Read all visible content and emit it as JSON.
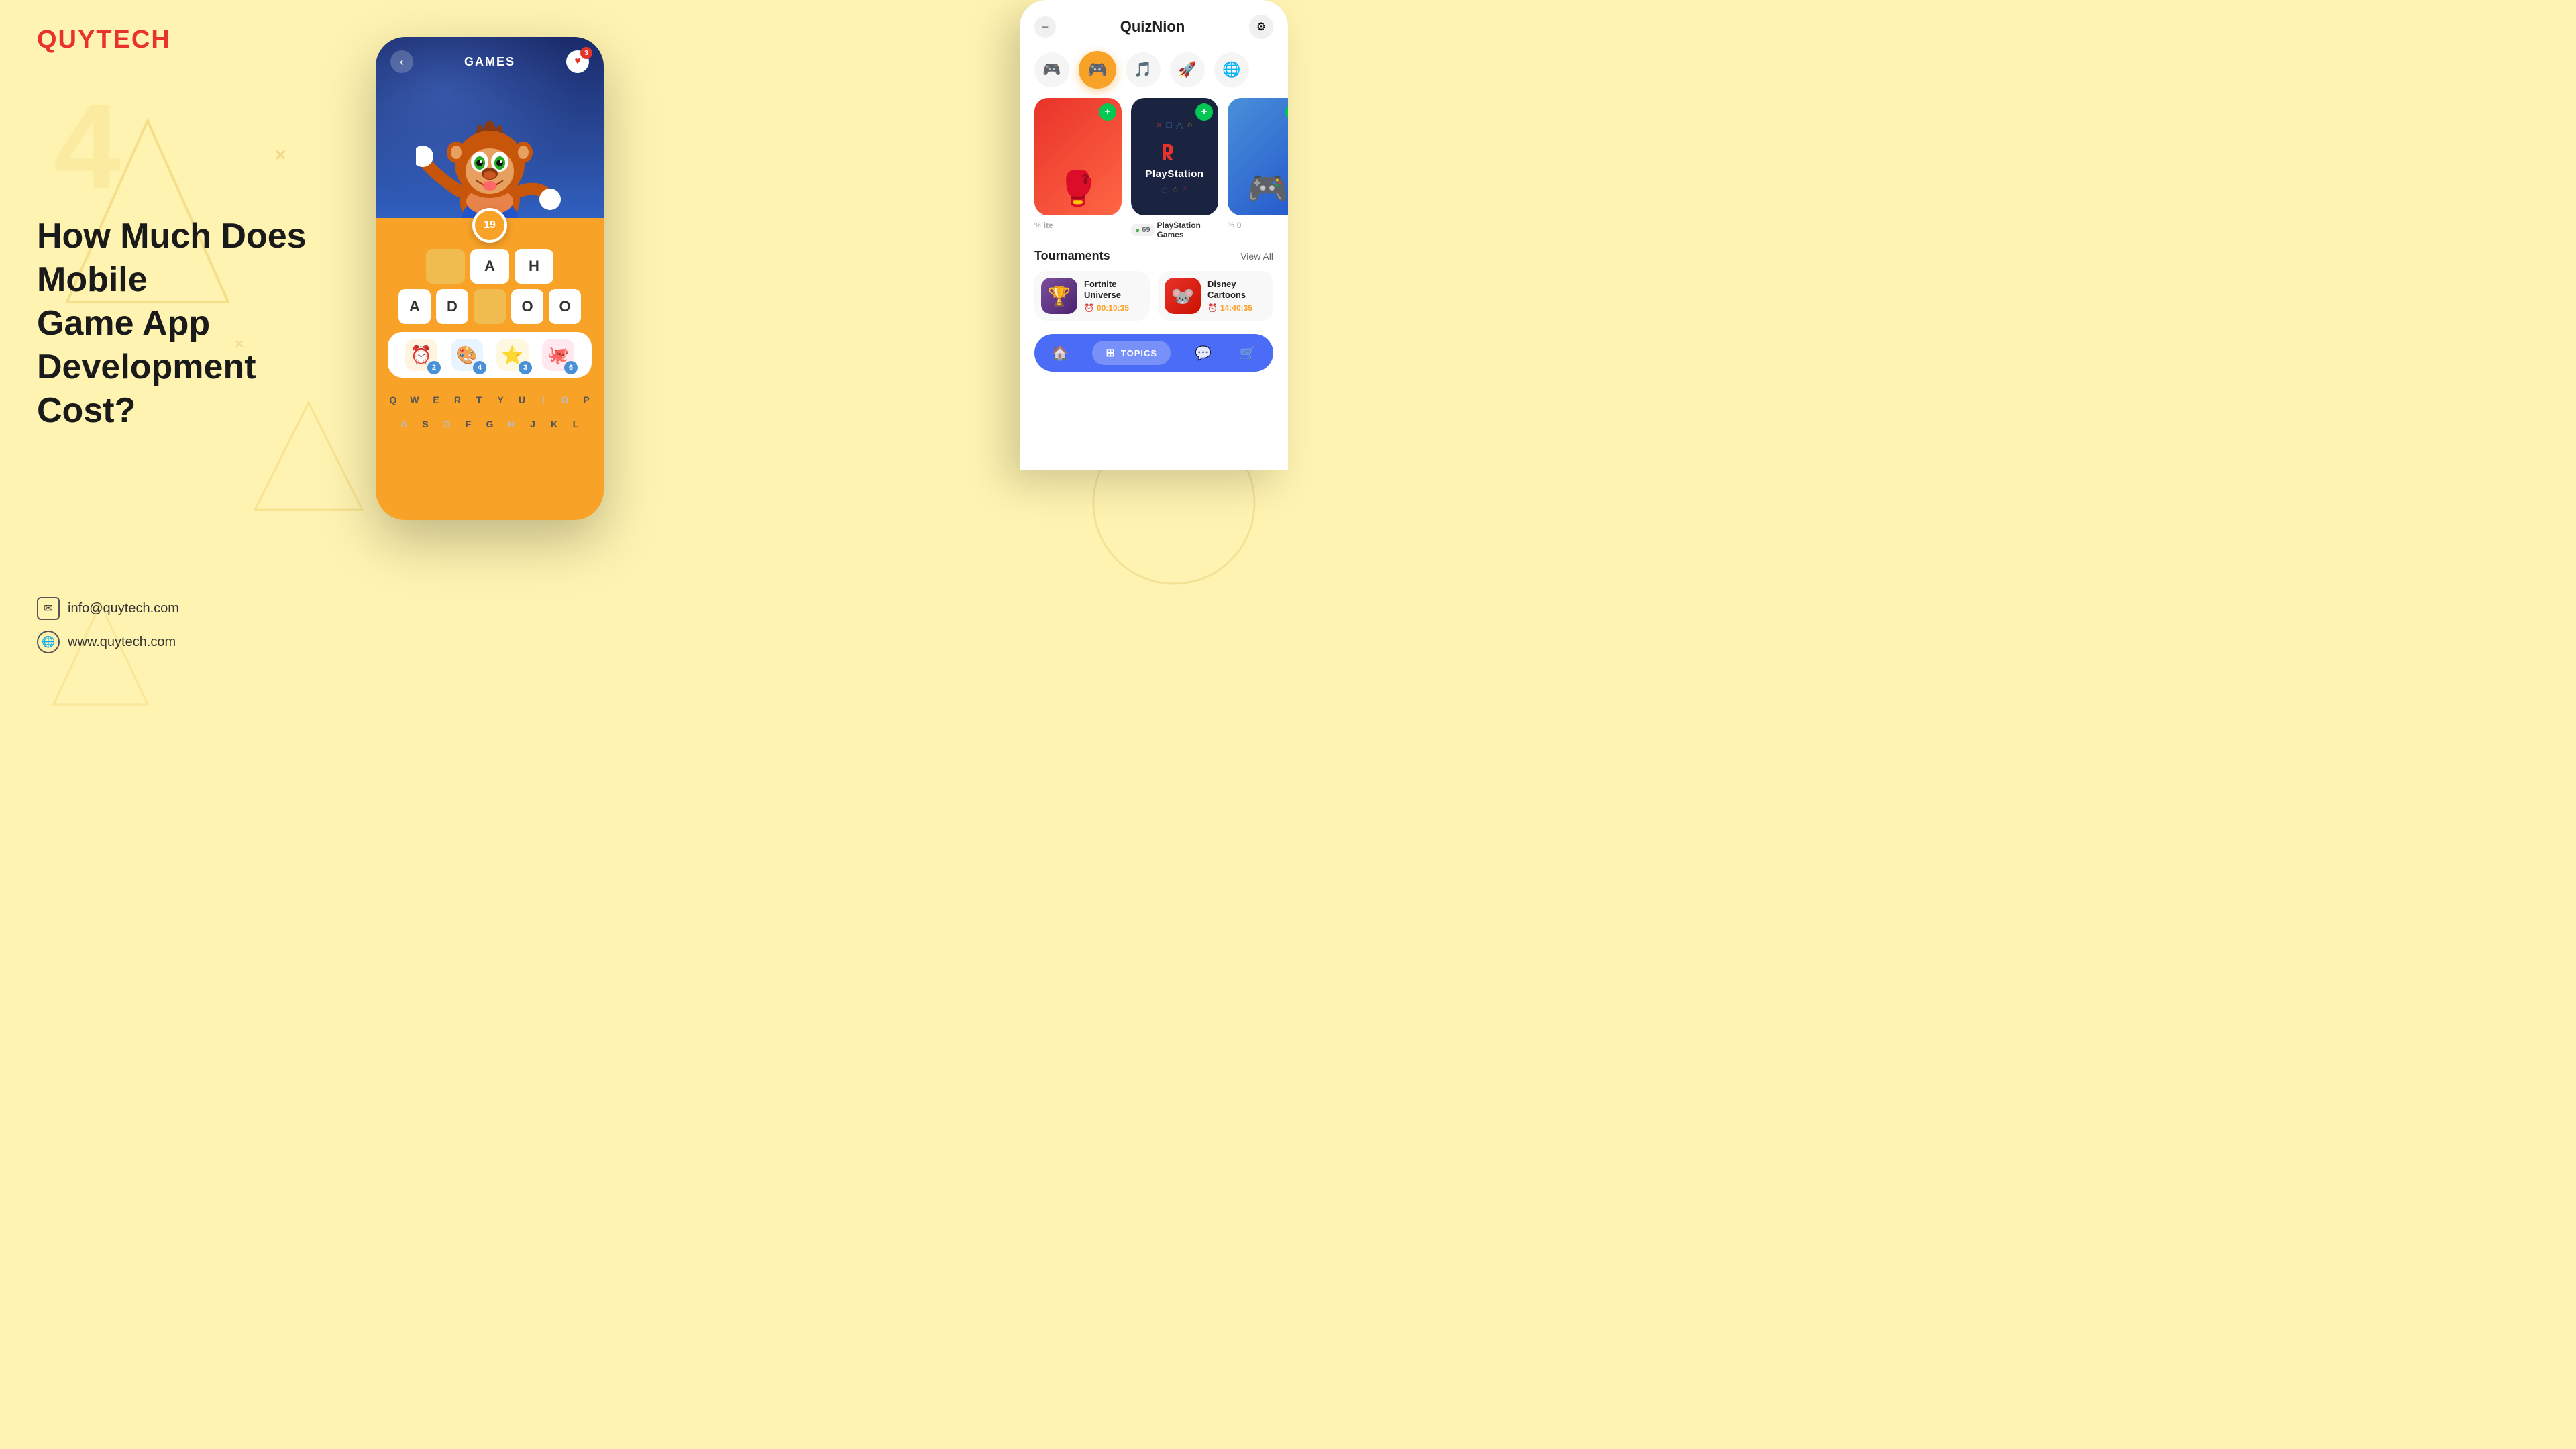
{
  "brand": {
    "logo": "QUYTECH",
    "logo_color": "#e8332a"
  },
  "page": {
    "background": "#fef3b0"
  },
  "heading": {
    "line1": "How Much Does Mobile",
    "line2": "Game App Development",
    "line3": "Cost?"
  },
  "contact": {
    "email_icon": "✉",
    "email": "info@quytech.com",
    "web_icon": "🌐",
    "website": "www.quytech.com"
  },
  "quiz_game_phone": {
    "header": "GAMES",
    "back_label": "‹",
    "heart_count": "3",
    "score": "19",
    "letter_rows": [
      [
        "",
        "A",
        "H"
      ],
      [
        "A",
        "D",
        "",
        "O",
        "O"
      ]
    ],
    "powerups": [
      {
        "icon": "⏰",
        "count": "2"
      },
      {
        "icon": "🎨",
        "count": "4"
      },
      {
        "icon": "⭐",
        "count": "3"
      },
      {
        "icon": "🐙",
        "count": "6"
      }
    ],
    "keyboard_row1": [
      "Q",
      "W",
      "E",
      "R",
      "T",
      "Y",
      "U",
      "I",
      "O",
      "P"
    ],
    "keyboard_row2": [
      "A",
      "S",
      "D",
      "F",
      "G",
      "H",
      "J",
      "K",
      "L"
    ]
  },
  "quiz_app_phone": {
    "title": "QuizNion",
    "categories": [
      {
        "icon": "🎮",
        "active": false
      },
      {
        "icon": "🎮",
        "active": true
      },
      {
        "icon": "🎵",
        "active": false
      },
      {
        "icon": "🚀",
        "active": false
      },
      {
        "icon": "🌐",
        "active": false
      }
    ],
    "game_cards": [
      {
        "name": "PlayStation Games",
        "score_badge": "69",
        "plus_color": "red",
        "type": "playstation"
      }
    ],
    "tournaments_section": {
      "title": "Tournaments",
      "view_all": "View All",
      "items": [
        {
          "name": "Fortnite Universe",
          "time": "00:10:35",
          "color": "#7b4f9e"
        },
        {
          "name": "Disney Cartoons",
          "time": "14:40:35",
          "color": "#e8332a"
        }
      ]
    },
    "bottom_nav": {
      "topics_label": "TOPICS",
      "icons": [
        "🏠",
        "⊞",
        "💬",
        "🛒"
      ]
    }
  },
  "ps_logo": "PlayStation",
  "ps_score": "69",
  "ps_label": "PlayStation Games"
}
